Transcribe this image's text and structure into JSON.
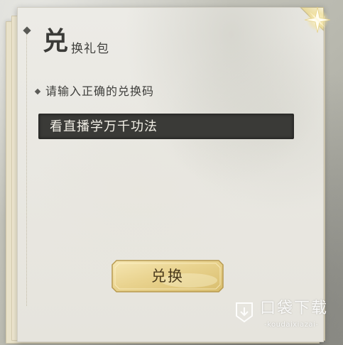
{
  "dialog": {
    "title_large": "兑",
    "title_small": "换礼包"
  },
  "form": {
    "hint": "请输入正确的兑换码",
    "code_value": "看直播学万千功法"
  },
  "actions": {
    "redeem_label": "兑换"
  },
  "watermark": {
    "title": "口袋下载",
    "subtitle": "-koudaixiazai-"
  },
  "icons": {
    "close": "sparkle-star-close-icon",
    "logo": "download-shield-icon"
  },
  "colors": {
    "paper": "#e8e6df",
    "ink": "#3b3b38",
    "input_bg": "#3a3a37",
    "button_gold": "#e6cf8a"
  }
}
